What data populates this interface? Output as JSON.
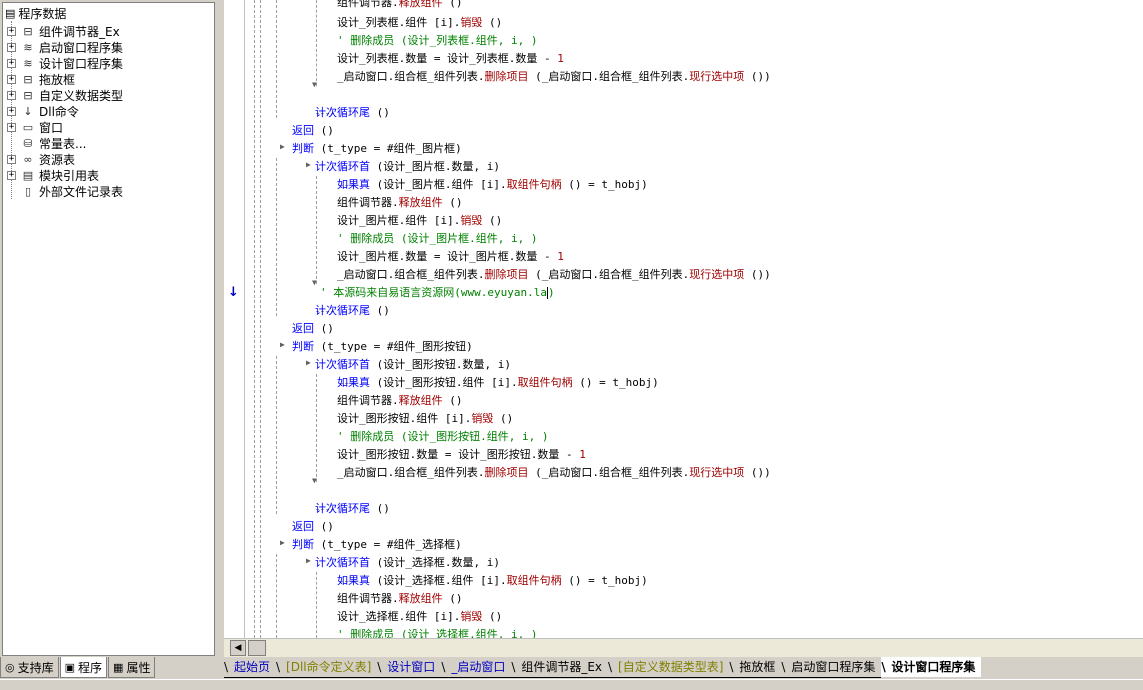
{
  "tree": {
    "root": "程序数据",
    "items": [
      {
        "label": "组件调节器_Ex",
        "icon": "class-module-icon"
      },
      {
        "label": "启动窗口程序集",
        "icon": "assembly-icon"
      },
      {
        "label": "设计窗口程序集",
        "icon": "assembly-icon"
      },
      {
        "label": "拖放框",
        "icon": "class-module-icon"
      },
      {
        "label": "自定义数据类型",
        "icon": "class-module-icon"
      },
      {
        "label": "Dll命令",
        "icon": "dll-icon"
      },
      {
        "label": "窗口",
        "icon": "window-icon"
      },
      {
        "label": "常量表...",
        "icon": "constant-icon"
      },
      {
        "label": "资源表",
        "icon": "resource-icon"
      },
      {
        "label": "模块引用表",
        "icon": "module-ref-icon"
      },
      {
        "label": "外部文件记录表",
        "icon": "file-record-icon"
      }
    ]
  },
  "left_tabs": [
    {
      "label": "支持库",
      "glyph": "◎"
    },
    {
      "label": "程序",
      "glyph": "▣"
    },
    {
      "label": "属性",
      "glyph": "▦"
    }
  ],
  "code": {
    "l01": "组件调节器.",
    "l01b": "释放组件",
    "l01c": " ()",
    "l02a": "设计_列表框.组件 [i].",
    "l02b": "销毁",
    "l02c": " ()",
    "l03": "' 删除成员 (设计_列表框.组件, i, )",
    "l04a": "设计_列表框.数量 = 设计_列表框.数量 - ",
    "l04b": "1",
    "l05a": "_启动窗口.组合框_组件列表.",
    "l05b": "删除项目",
    "l05c": " (_启动窗口.组合框_组件列表.",
    "l05d": "现行选中项",
    "l05e": " ())",
    "l06": "计次循环尾",
    "l06b": " ()",
    "l07": "返回",
    "l07b": " ()",
    "l08": "判断",
    "l08b": " (t_type = #组件_图片框)",
    "l09": "计次循环首",
    "l09b": " (设计_图片框.数量, i)",
    "l10": "如果真",
    "l10b": " (设计_图片框.组件 [i].",
    "l10c": "取组件句柄",
    "l10d": " () = t_hobj)",
    "l11": "组件调节器.",
    "l11b": "释放组件",
    "l11c": " ()",
    "l12a": "设计_图片框.组件 [i].",
    "l12b": "销毁",
    "l12c": " ()",
    "l13": "' 删除成员 (设计_图片框.组件, i, )",
    "l14a": "设计_图片框.数量 = 设计_图片框.数量 - ",
    "l14b": "1",
    "l15a": "_启动窗口.组合框_组件列表.",
    "l15b": "删除项目",
    "l15c": " (_启动窗口.组合框_组件列表.",
    "l15d": "现行选中项",
    "l15e": " ())",
    "l16": "' 本源码来自易语言资源网(www.eyuyan.la",
    "l16b": ")",
    "l17": "计次循环尾",
    "l17b": " ()",
    "l18": "返回",
    "l18b": " ()",
    "l19": "判断",
    "l19b": " (t_type = #组件_图形按钮)",
    "l20": "计次循环首",
    "l20b": " (设计_图形按钮.数量, i)",
    "l21": "如果真",
    "l21b": " (设计_图形按钮.组件 [i].",
    "l21c": "取组件句柄",
    "l21d": " () = t_hobj)",
    "l22": "组件调节器.",
    "l22b": "释放组件",
    "l22c": " ()",
    "l23a": "设计_图形按钮.组件 [i].",
    "l23b": "销毁",
    "l23c": " ()",
    "l24": "' 删除成员 (设计_图形按钮.组件, i, )",
    "l25a": "设计_图形按钮.数量 = 设计_图形按钮.数量 - ",
    "l25b": "1",
    "l26a": "_启动窗口.组合框_组件列表.",
    "l26b": "删除项目",
    "l26c": " (_启动窗口.组合框_组件列表.",
    "l26d": "现行选中项",
    "l26e": " ())",
    "l27": "计次循环尾",
    "l27b": " ()",
    "l28": "返回",
    "l28b": " ()",
    "l29": "判断",
    "l29b": " (t_type = #组件_选择框)",
    "l30": "计次循环首",
    "l30b": " (设计_选择框.数量, i)",
    "l31": "如果真",
    "l31b": " (设计_选择框.组件 [i].",
    "l31c": "取组件句柄",
    "l31d": " () = t_hobj)",
    "l32": "组件调节器.",
    "l32b": "释放组件",
    "l32c": " ()",
    "l33a": "设计_选择框.组件 [i].",
    "l33b": "销毁",
    "l33c": " ()",
    "l34": "' 删除成员 (设计_选择框.组件, i, )"
  },
  "tabs": [
    {
      "label": "起始页",
      "style": "blue"
    },
    {
      "label": "[Dll命令定义表]",
      "style": "olive"
    },
    {
      "label": "设计窗口",
      "style": "blue"
    },
    {
      "label": "_启动窗口",
      "style": "blue"
    },
    {
      "label": "组件调节器_Ex",
      "style": "normal"
    },
    {
      "label": "[自定义数据类型表]",
      "style": "olive"
    },
    {
      "label": "拖放框",
      "style": "normal"
    },
    {
      "label": "启动窗口程序集",
      "style": "normal"
    },
    {
      "label": "设计窗口程序集",
      "style": "active"
    }
  ],
  "colors": {
    "keyword": "#0000ff",
    "function": "#a00000",
    "comment": "#008000"
  }
}
